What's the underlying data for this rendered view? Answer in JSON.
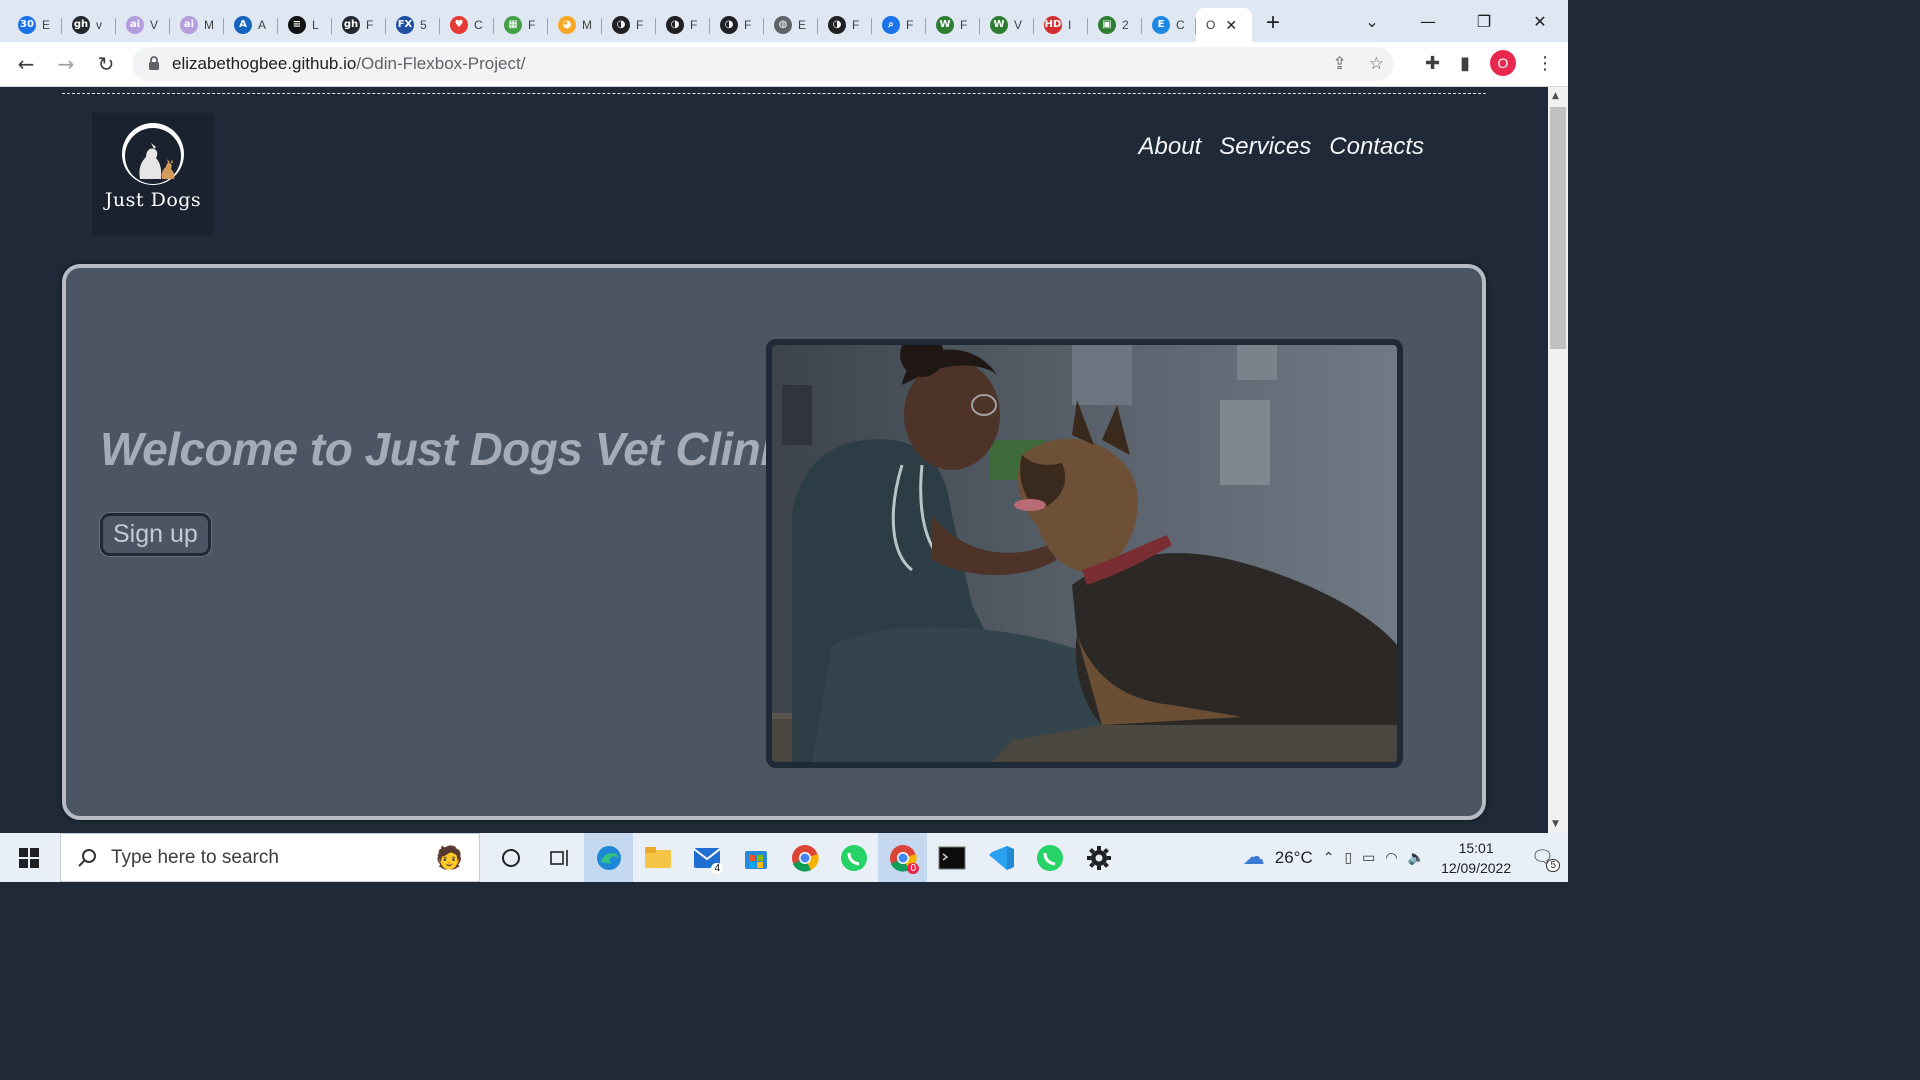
{
  "browser": {
    "tabs": [
      {
        "icon": "30",
        "letter": "E",
        "color": "#1a73e8"
      },
      {
        "icon": "gh",
        "letter": "v",
        "color": "#24292f"
      },
      {
        "icon": "ai",
        "letter": "V",
        "color": "#b39ddb"
      },
      {
        "icon": "ai",
        "letter": "M",
        "color": "#b39ddb"
      },
      {
        "icon": "A",
        "letter": "A",
        "color": "#1565c0"
      },
      {
        "icon": "≡",
        "letter": "L",
        "color": "#111111"
      },
      {
        "icon": "gh",
        "letter": "F",
        "color": "#24292f"
      },
      {
        "icon": "FX",
        "letter": "5",
        "color": "#1e4fa3"
      },
      {
        "icon": "♥",
        "letter": "C",
        "color": "#e53935"
      },
      {
        "icon": "▦",
        "letter": "F",
        "color": "#43a047"
      },
      {
        "icon": "◕",
        "letter": "M",
        "color": "#f9a825"
      },
      {
        "icon": "◑",
        "letter": "F",
        "color": "#202124"
      },
      {
        "icon": "◑",
        "letter": "F",
        "color": "#202124"
      },
      {
        "icon": "◑",
        "letter": "F",
        "color": "#202124"
      },
      {
        "icon": "◍",
        "letter": "E",
        "color": "#5f6368"
      },
      {
        "icon": "◑",
        "letter": "F",
        "color": "#202124"
      },
      {
        "icon": "⌕",
        "letter": "F",
        "color": "#1a73e8"
      },
      {
        "icon": "W",
        "letter": "F",
        "color": "#2e7d32"
      },
      {
        "icon": "W",
        "letter": "V",
        "color": "#2e7d32"
      },
      {
        "icon": "HD",
        "letter": "I",
        "color": "#d32f2f"
      },
      {
        "icon": "▣",
        "letter": "2",
        "color": "#2e7d32"
      },
      {
        "icon": "E",
        "letter": "C",
        "color": "#1e88e5"
      }
    ],
    "active_tab_letter": "O",
    "url_host": "elizabethogbee.github.io",
    "url_path": "/Odin-Flexbox-Project/",
    "profile_initial": "O"
  },
  "site": {
    "logo_text": "Just  Dogs",
    "nav": [
      "About",
      "Services",
      "Contacts"
    ],
    "hero_title": "Welcome to Just Dogs Vet Clinic!",
    "signup_label": "Sign up"
  },
  "taskbar": {
    "search_placeholder": "Type here to search",
    "mail_badge": "4",
    "chrome_badge": "0",
    "temperature": "26°C",
    "time": "15:01",
    "date": "12/09/2022",
    "notifications": "5"
  },
  "colors": {
    "page_bg": "#1f2937",
    "hero_bg": "#4b5563",
    "hero_border": "#b7bcc4",
    "hero_text": "#a5acb7"
  }
}
